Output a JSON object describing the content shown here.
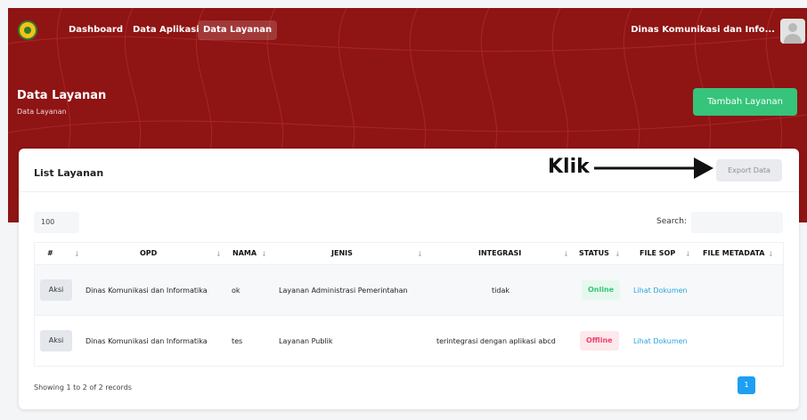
{
  "nav": {
    "items": [
      {
        "label": "Dashboard"
      },
      {
        "label": "Data Aplikasi"
      },
      {
        "label": "Data Layanan"
      }
    ],
    "user_name": "Dinas Komunikasi dan Info..."
  },
  "header": {
    "title": "Data Layanan",
    "breadcrumb": "Data Layanan",
    "add_button": "Tambah Layanan"
  },
  "card": {
    "title": "List Layanan",
    "annotation": "Klik",
    "export_button": "Export Data"
  },
  "controls": {
    "page_length": "100",
    "search_label": "Search:",
    "search_value": ""
  },
  "table": {
    "headers": [
      "#",
      "OPD",
      "NAMA",
      "JENIS",
      "INTEGRASI",
      "STATUS",
      "FILE SOP",
      "FILE METADATA"
    ],
    "rows": [
      {
        "action": "Aksi",
        "opd": "Dinas Komunikasi dan Informatika",
        "nama": "ok",
        "jenis": "Layanan Administrasi Pemerintahan",
        "integrasi": "tidak",
        "status": "Online",
        "file_sop": "Lihat Dokumen",
        "file_metadata": ""
      },
      {
        "action": "Aksi",
        "opd": "Dinas Komunikasi dan Informatika",
        "nama": "tes",
        "jenis": "Layanan Publik",
        "integrasi": "terintegrasi dengan aplikasi abcd",
        "status": "Offline",
        "file_sop": "Lihat Dokumen",
        "file_metadata": ""
      }
    ]
  },
  "footer": {
    "info": "Showing 1 to 2 of 2 records",
    "current_page": "1"
  },
  "colors": {
    "hero": "#8f1414",
    "primary_green": "#35c47a",
    "link_blue": "#2aa4e0",
    "offline_red": "#f1416c",
    "pagination_blue": "#1e9ff2"
  }
}
